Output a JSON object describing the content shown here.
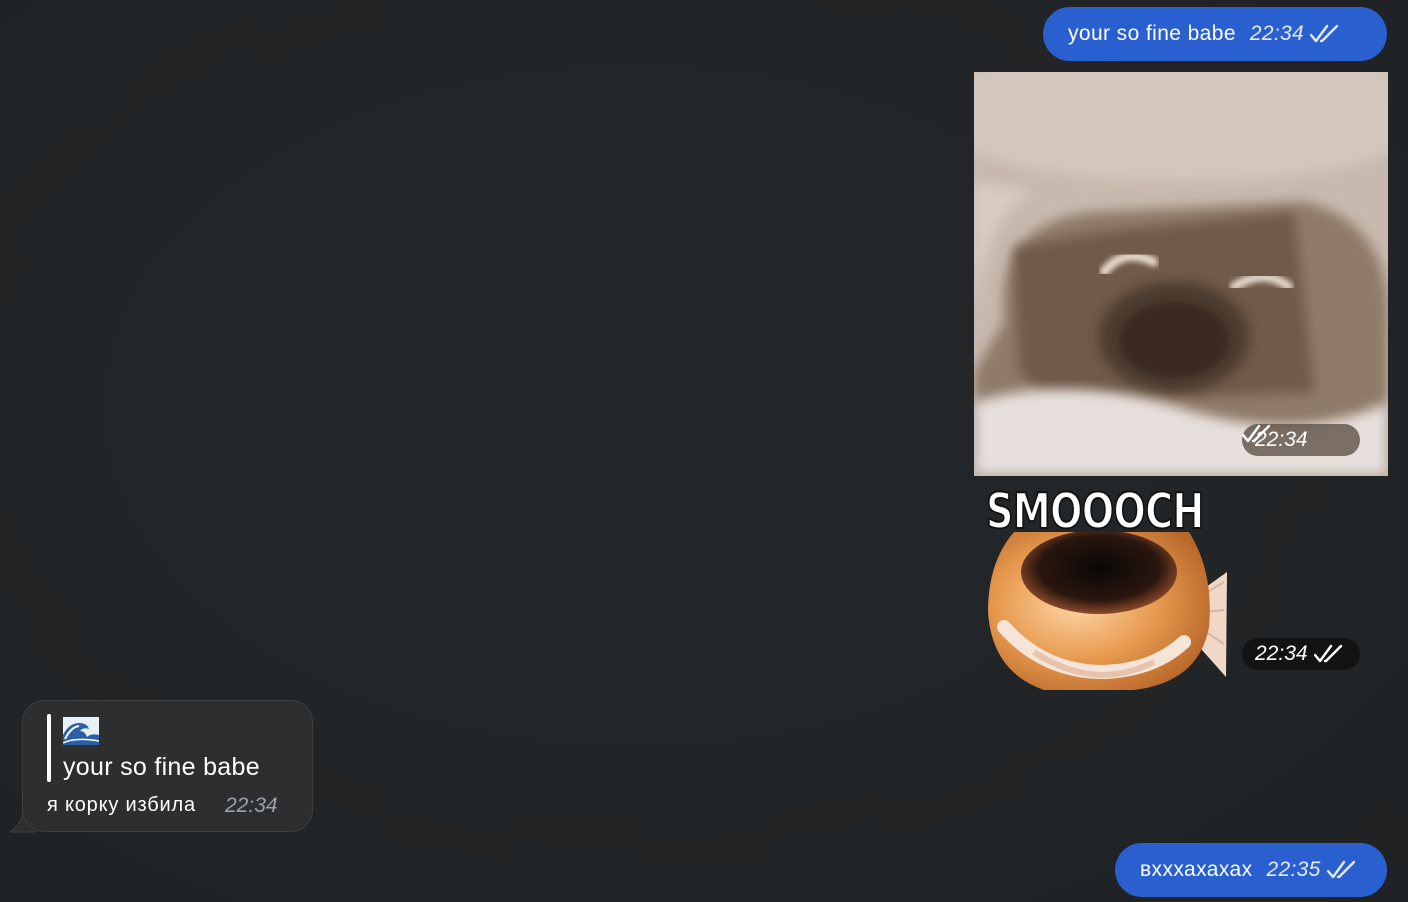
{
  "messages": {
    "m1": {
      "text": "your so fine babe",
      "time": "22:34",
      "status": "read-double-check"
    },
    "photo": {
      "time": "22:34",
      "status": "read-double-check",
      "content": "crying face photo"
    },
    "sticker": {
      "caption": "SMOOOCH",
      "time": "22:34",
      "status": "read-double-check"
    },
    "m4": {
      "reply_emoji": "🌊",
      "reply_text": "your so fine babe",
      "text": "я корку избила",
      "time": "22:34"
    },
    "m5": {
      "text": "вхххахахах",
      "time": "22:35",
      "status": "read-double-check"
    }
  },
  "colors": {
    "background": "#222527",
    "outgoing_bubble": "#2a5fd0",
    "incoming_bubble": "#2c2e30",
    "incoming_time": "#9aa3ad"
  }
}
